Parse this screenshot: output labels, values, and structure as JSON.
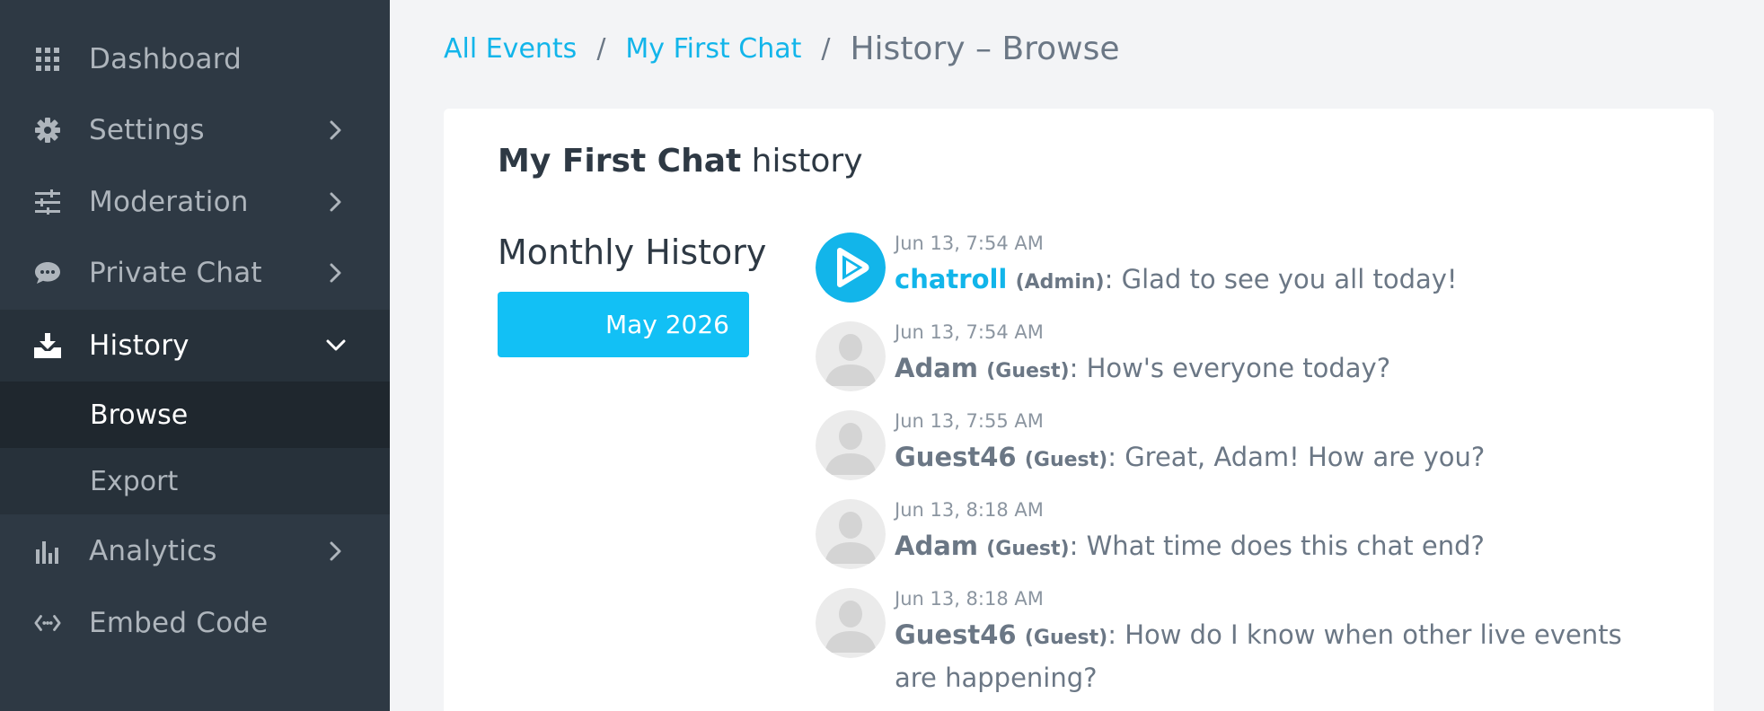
{
  "sidebar": {
    "items": [
      {
        "label": "Dashboard",
        "icon": "grid-icon"
      },
      {
        "label": "Settings",
        "icon": "gear-icon"
      },
      {
        "label": "Moderation",
        "icon": "sliders-icon"
      },
      {
        "label": "Private Chat",
        "icon": "chat-bubble-icon"
      },
      {
        "label": "History",
        "icon": "download-tray-icon"
      },
      {
        "label": "Analytics",
        "icon": "bar-chart-icon"
      },
      {
        "label": "Embed Code",
        "icon": "code-icon"
      }
    ],
    "history_sub": [
      {
        "label": "Browse"
      },
      {
        "label": "Export"
      }
    ]
  },
  "breadcrumb": {
    "link1": "All Events",
    "link2": "My First Chat",
    "sep": "/",
    "current": "History – Browse"
  },
  "card": {
    "title_bold": "My First Chat",
    "title_rest": " history"
  },
  "monthly": {
    "title": "Monthly History",
    "button": "May 2026"
  },
  "messages": [
    {
      "time": "Jun 13, 7:54 AM",
      "author": "chatroll",
      "role": "(Admin)",
      "text": ": Glad to see you all today!"
    },
    {
      "time": "Jun 13, 7:54 AM",
      "author": "Adam",
      "role": "(Guest)",
      "text": ": How's everyone today?"
    },
    {
      "time": "Jun 13, 7:55 AM",
      "author": "Guest46",
      "role": "(Guest)",
      "text": ": Great, Adam! How are you?"
    },
    {
      "time": "Jun 13, 8:18 AM",
      "author": "Adam",
      "role": "(Guest)",
      "text": ": What time does this chat end?"
    },
    {
      "time": "Jun 13, 8:18 AM",
      "author": "Guest46",
      "role": "(Guest)",
      "text": ": How do I know when other live events are happening?"
    }
  ],
  "colors": {
    "accent": "#12c0f5",
    "sidebar_bg": "#2e3944",
    "sidebar_active": "#27313a",
    "text_muted": "#6b7785"
  }
}
